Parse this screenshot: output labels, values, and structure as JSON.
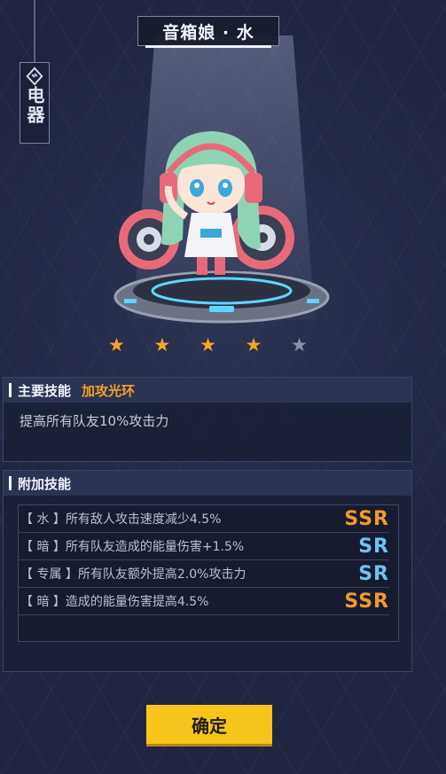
{
  "character": {
    "name": "音箱娘 · 水",
    "category": "电器",
    "stars_total": 5,
    "stars_filled": 4,
    "star_glyph": "★"
  },
  "main_skill": {
    "header": "主要技能",
    "name": "加攻光环",
    "description": "提高所有队友10%攻击力"
  },
  "extra_skills": {
    "header": "附加技能",
    "items": [
      {
        "text": "【 水 】所有敌人攻击速度减少4.5%",
        "rank": "SSR",
        "rank_color": "#f29a2a"
      },
      {
        "text": "【 暗 】所有队友造成的能量伤害+1.5%",
        "rank": "SR",
        "rank_color": "#6ec4f1"
      },
      {
        "text": "【 专属 】所有队友额外提高2.0%攻击力",
        "rank": "SR",
        "rank_color": "#6ec4f1"
      },
      {
        "text": "【 暗 】造成的能量伤害提高4.5%",
        "rank": "SSR",
        "rank_color": "#f29a2a"
      }
    ]
  },
  "actions": {
    "confirm_label": "确定"
  },
  "colors": {
    "star_filled": "#f5a623",
    "star_empty": "#8c93a8",
    "accent": "#f4a326",
    "button": "#f7c41b"
  }
}
